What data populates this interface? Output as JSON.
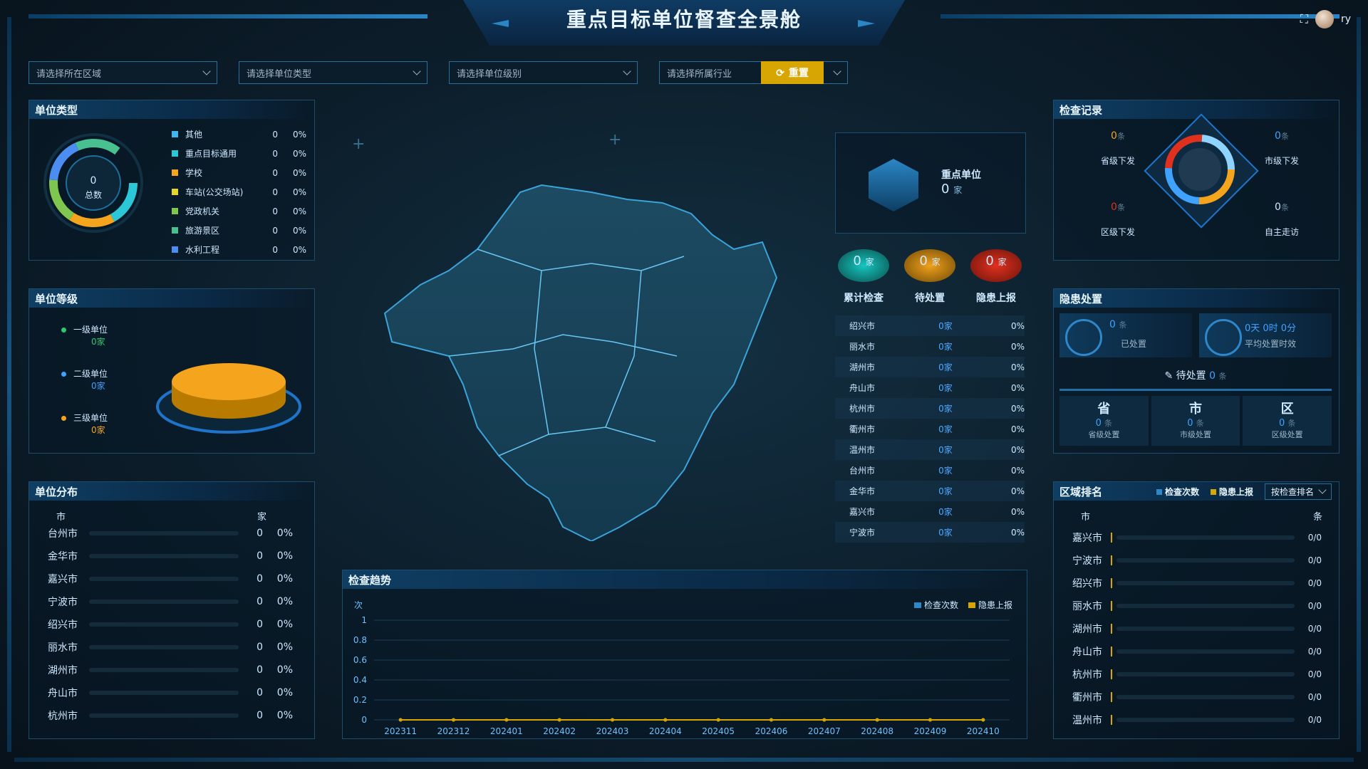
{
  "header": {
    "title": "重点目标单位督查全景舱",
    "user": "ry"
  },
  "filters": {
    "region": "请选择所在区域",
    "unit_type": "请选择单位类型",
    "unit_level": "请选择单位级别",
    "industry": "请选择所属行业",
    "reset": "重置"
  },
  "unit_type": {
    "title": "单位类型",
    "total_value": "0",
    "total_label": "总数",
    "items": [
      {
        "label": "其他",
        "count": "0",
        "pct": "0%",
        "color": "#3fb6f0"
      },
      {
        "label": "重点目标通用",
        "count": "0",
        "pct": "0%",
        "color": "#2cc7d6"
      },
      {
        "label": "学校",
        "count": "0",
        "pct": "0%",
        "color": "#f4a41d"
      },
      {
        "label": "车站(公交场站)",
        "count": "0",
        "pct": "0%",
        "color": "#e5d42a"
      },
      {
        "label": "党政机关",
        "count": "0",
        "pct": "0%",
        "color": "#7ec64f"
      },
      {
        "label": "旅游景区",
        "count": "0",
        "pct": "0%",
        "color": "#48c08f"
      },
      {
        "label": "水利工程",
        "count": "0",
        "pct": "0%",
        "color": "#4b8df1"
      }
    ]
  },
  "unit_level": {
    "title": "单位等级",
    "items": [
      {
        "label": "一级单位",
        "value": "0家",
        "color": "#2cc970"
      },
      {
        "label": "二级单位",
        "value": "0家",
        "color": "#3fa2ff"
      },
      {
        "label": "三级单位",
        "value": "0家",
        "color": "#f4a41d"
      }
    ]
  },
  "unit_distribution": {
    "title": "单位分布",
    "header_city": "市",
    "header_unit": "家",
    "rows": [
      {
        "city": "台州市",
        "count": "0",
        "pct": "0%"
      },
      {
        "city": "金华市",
        "count": "0",
        "pct": "0%"
      },
      {
        "city": "嘉兴市",
        "count": "0",
        "pct": "0%"
      },
      {
        "city": "宁波市",
        "count": "0",
        "pct": "0%"
      },
      {
        "city": "绍兴市",
        "count": "0",
        "pct": "0%"
      },
      {
        "city": "丽水市",
        "count": "0",
        "pct": "0%"
      },
      {
        "city": "湖州市",
        "count": "0",
        "pct": "0%"
      },
      {
        "city": "舟山市",
        "count": "0",
        "pct": "0%"
      },
      {
        "city": "杭州市",
        "count": "0",
        "pct": "0%"
      }
    ]
  },
  "key_unit": {
    "label": "重点单位",
    "value": "0",
    "unit": "家"
  },
  "stats": [
    {
      "value": "0",
      "unit": "家",
      "label": "累计检查",
      "color": "#16c6c0"
    },
    {
      "value": "0",
      "unit": "家",
      "label": "待处置",
      "color": "#f0a11c"
    },
    {
      "value": "0",
      "unit": "家",
      "label": "隐患上报",
      "color": "#e0311f"
    }
  ],
  "city_table": [
    {
      "city": "绍兴市",
      "count": "0家",
      "pct": "0%"
    },
    {
      "city": "丽水市",
      "count": "0家",
      "pct": "0%"
    },
    {
      "city": "湖州市",
      "count": "0家",
      "pct": "0%"
    },
    {
      "city": "舟山市",
      "count": "0家",
      "pct": "0%"
    },
    {
      "city": "杭州市",
      "count": "0家",
      "pct": "0%"
    },
    {
      "city": "衢州市",
      "count": "0家",
      "pct": "0%"
    },
    {
      "city": "温州市",
      "count": "0家",
      "pct": "0%"
    },
    {
      "city": "台州市",
      "count": "0家",
      "pct": "0%"
    },
    {
      "city": "金华市",
      "count": "0家",
      "pct": "0%"
    },
    {
      "city": "嘉兴市",
      "count": "0家",
      "pct": "0%"
    },
    {
      "city": "宁波市",
      "count": "0家",
      "pct": "0%"
    }
  ],
  "inspection_records": {
    "title": "检查记录",
    "items": [
      {
        "value": "0",
        "unit": "条",
        "label": "省级下发"
      },
      {
        "value": "0",
        "unit": "条",
        "label": "市级下发"
      },
      {
        "value": "0",
        "unit": "条",
        "label": "区级下发"
      },
      {
        "value": "0",
        "unit": "条",
        "label": "自主走访"
      }
    ]
  },
  "hazard": {
    "title": "隐患处置",
    "handled_value": "0",
    "handled_unit": "条",
    "handled_label": "已处置",
    "avg_time": "0天 0时 0分",
    "avg_label": "平均处置时效",
    "pending_label": "待处置",
    "pending_value": "0",
    "pending_unit": "条",
    "levels": [
      {
        "head": "省",
        "value": "0",
        "unit": "条",
        "label": "省级处置"
      },
      {
        "head": "市",
        "value": "0",
        "unit": "条",
        "label": "市级处置"
      },
      {
        "head": "区",
        "value": "0",
        "unit": "条",
        "label": "区级处置"
      }
    ]
  },
  "region_rank": {
    "title": "区域排名",
    "legend": [
      "检查次数",
      "隐患上报"
    ],
    "sort": "按检查排名",
    "header_city": "市",
    "header_unit": "条",
    "rows": [
      {
        "city": "嘉兴市",
        "value": "0/0"
      },
      {
        "city": "宁波市",
        "value": "0/0"
      },
      {
        "city": "绍兴市",
        "value": "0/0"
      },
      {
        "city": "丽水市",
        "value": "0/0"
      },
      {
        "city": "湖州市",
        "value": "0/0"
      },
      {
        "city": "舟山市",
        "value": "0/0"
      },
      {
        "city": "杭州市",
        "value": "0/0"
      },
      {
        "city": "衢州市",
        "value": "0/0"
      },
      {
        "city": "温州市",
        "value": "0/0"
      }
    ]
  },
  "chart_data": {
    "type": "line",
    "title": "检查趋势",
    "ylabel": "次",
    "categories": [
      "202311",
      "202312",
      "202401",
      "202402",
      "202403",
      "202404",
      "202405",
      "202406",
      "202407",
      "202408",
      "202409",
      "202410"
    ],
    "series": [
      {
        "name": "检查次数",
        "values": [
          0,
          0,
          0,
          0,
          0,
          0,
          0,
          0,
          0,
          0,
          0,
          0
        ],
        "color": "#2f86c8"
      },
      {
        "name": "隐患上报",
        "values": [
          0,
          0,
          0,
          0,
          0,
          0,
          0,
          0,
          0,
          0,
          0,
          0
        ],
        "color": "#d8a602"
      }
    ],
    "yticks": [
      "1",
      "0.8",
      "0.6",
      "0.4",
      "0.2",
      "0"
    ],
    "ylim": [
      0,
      1
    ]
  },
  "icons": {
    "fullscreen": "fullscreen-icon",
    "refresh": "refresh-icon"
  }
}
